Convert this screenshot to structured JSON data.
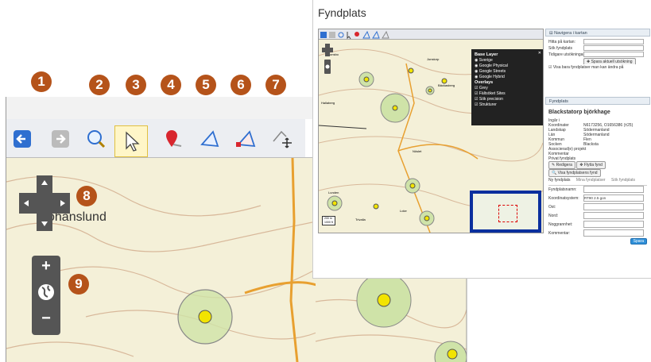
{
  "callouts": [
    "1",
    "2",
    "3",
    "4",
    "5",
    "6",
    "7",
    "8",
    "9"
  ],
  "zoomed": {
    "place_label": "Johanslund",
    "toolbar_icons": [
      "back-arrow-icon",
      "forward-arrow-icon",
      "magnify-icon",
      "pointer-arrow-icon",
      "map-pin-icon",
      "polygon-icon",
      "polygon-edit-icon",
      "polygon-move-icon"
    ],
    "zoom_in": "+",
    "zoom_out": "−"
  },
  "screenshot": {
    "title": "Fyndplats",
    "map_labels": [
      "Jonsbo",
      "Jonstorp",
      "Hallaberg",
      "Bäckasberg",
      "Nöslet",
      "Lunden",
      "Loke",
      "Trivalla"
    ],
    "scale_labels": [
      "200 m",
      "1000 ft"
    ],
    "layer_switcher": {
      "base_title": "Base Layer",
      "base": [
        "Sverige",
        "Google Physical",
        "Google Streets",
        "Google Hybrid"
      ],
      "overlay_title": "Overlays",
      "overlays": [
        "Grey",
        "Fältsöket Sites",
        "Sök precision",
        "Strukturer"
      ]
    },
    "nav_panel": {
      "header": "Navigera i kartan",
      "find_map": "Hitta på kartan:",
      "find_site": "Sök fyndplats",
      "earlier": "Tidigare utsökningar:",
      "save_btn": "Spara aktuell utsökning",
      "checkbox": "Visa bara fyndplatser man kan ändra på"
    },
    "site_panel": {
      "header": "Fyndplats",
      "name": "Blackstatorp björkhage",
      "fields": [
        {
          "label": "Ingår i",
          "value": ""
        },
        {
          "label": "Koordinater",
          "value": "N6173256, O1656386  (±25)"
        },
        {
          "label": "Landskap",
          "value": "Södermanland"
        },
        {
          "label": "Län",
          "value": "Södermanland"
        },
        {
          "label": "Kommun",
          "value": "Flen"
        },
        {
          "label": "Socken",
          "value": "Blacksta"
        },
        {
          "label": "Associerad(e) projekt",
          "value": ""
        },
        {
          "label": "Kommentar",
          "value": ""
        },
        {
          "label": "Privat fyndplats",
          "value": ""
        }
      ],
      "edit_btn": "Redigera",
      "move_btn": "Flytta fynd",
      "show_btn": "Visa fyndplatsens fynd",
      "tabs": [
        "Ny fyndplats",
        "Mina fyndplatser",
        "Sök fyndplats"
      ],
      "form": [
        {
          "label": "Fyndplatsnamn:",
          "value": ""
        },
        {
          "label": "Koordinatsystem:",
          "value": "RT90 2.5 gon"
        },
        {
          "label": "Ost:",
          "value": ""
        },
        {
          "label": "Nord:",
          "value": ""
        },
        {
          "label": "Noggrannhet:",
          "value": ""
        },
        {
          "label": "Kommentar:",
          "value": ""
        }
      ],
      "save": "Spara"
    }
  },
  "colors": {
    "callout": "#b5531a",
    "circle_fill": "#cfe3a8",
    "marker": "#f2e400"
  }
}
